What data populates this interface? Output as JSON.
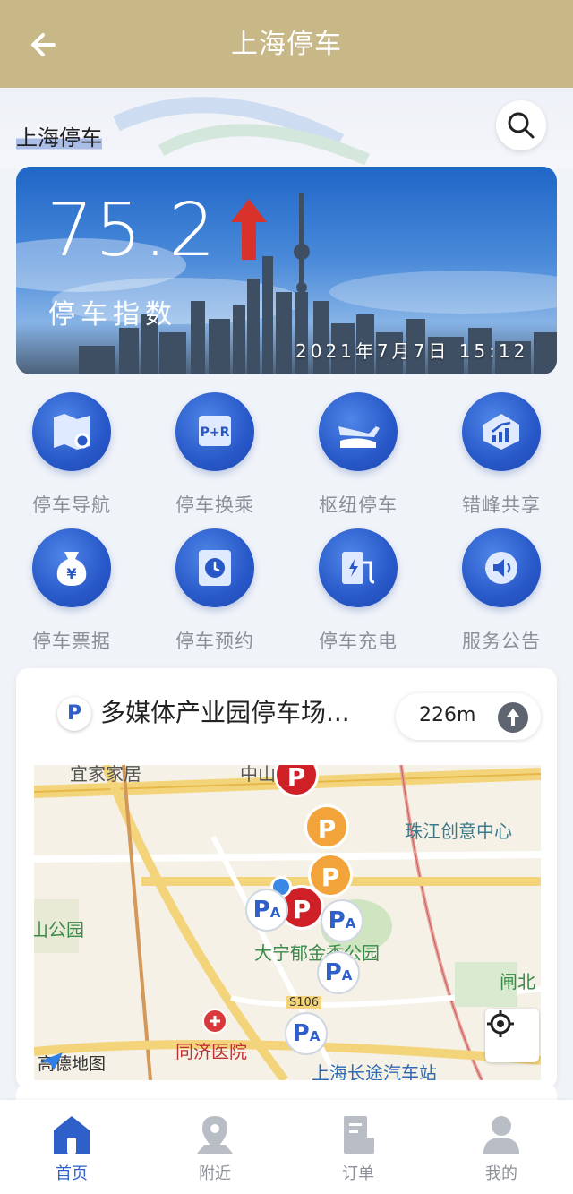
{
  "header": {
    "title": "上海停车",
    "back_icon": "arrow-left-icon"
  },
  "search": {
    "city_label": "上海停车",
    "icon": "search-icon"
  },
  "banner": {
    "index_value": "75.2",
    "trend": "up",
    "trend_color": "#d9322a",
    "label": "停车指数",
    "timestamp": "2021年7月7日 15:12"
  },
  "menu": [
    {
      "label": "停车导航",
      "icon": "map-pin-icon"
    },
    {
      "label": "停车换乘",
      "icon": "park-and-ride-icon"
    },
    {
      "label": "枢纽停车",
      "icon": "airplane-train-icon"
    },
    {
      "label": "错峰共享",
      "icon": "chart-growth-icon"
    },
    {
      "label": "停车票据",
      "icon": "money-bag-icon"
    },
    {
      "label": "停车预约",
      "icon": "clock-calendar-icon"
    },
    {
      "label": "停车充电",
      "icon": "charging-station-icon"
    },
    {
      "label": "服务公告",
      "icon": "speaker-icon"
    }
  ],
  "lot": {
    "badge": "P",
    "name": "多媒体产业园停车场...",
    "distance": "226m"
  },
  "map": {
    "labels": {
      "top_left_poi": "宜家家居",
      "top_road": "中山",
      "zhujiang": "珠江创意中心",
      "park_left": "山公园",
      "daning": "大宁郁金香公园",
      "zhabei": "闸北",
      "road_code": "S106",
      "hospital": "同济医院",
      "bus_station": "上海长途汽车站",
      "logo": "高德地图"
    },
    "markers": {
      "p": "P",
      "pa_main": "P",
      "pa_sub": "A"
    }
  },
  "tabs": [
    {
      "label": "首页",
      "icon": "home-icon",
      "active": true
    },
    {
      "label": "附近",
      "icon": "location-pin-icon",
      "active": false
    },
    {
      "label": "订单",
      "icon": "receipt-icon",
      "active": false
    },
    {
      "label": "我的",
      "icon": "user-icon",
      "active": false
    }
  ],
  "colors": {
    "header_bg": "#c8b888",
    "accent": "#2f5fc9",
    "marker_red": "#cf2028",
    "marker_orange": "#f2a33a"
  }
}
